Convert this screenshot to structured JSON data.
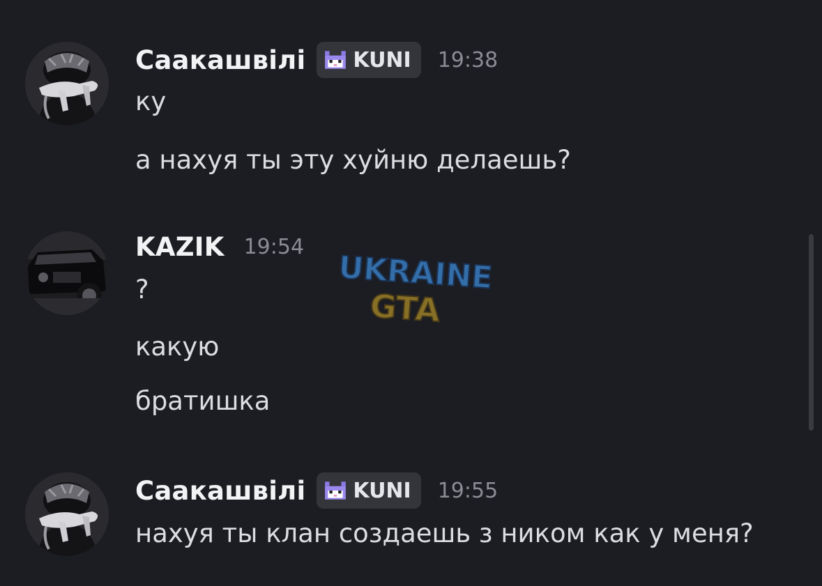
{
  "messages": [
    {
      "username": "Саакашвілі",
      "tag": "KUNI",
      "time": "19:38",
      "lines": [
        "ку",
        "а нахуя ты эту хуйню делаешь?"
      ]
    },
    {
      "username": "KAZIK",
      "time": "19:54",
      "lines": [
        "?",
        "какую",
        "братишка"
      ]
    },
    {
      "username": "Саакашвілі",
      "tag": "KUNI",
      "time": "19:55",
      "lines": [
        "нахуя ты клан создаешь з ником как у меня?"
      ]
    }
  ],
  "watermark": {
    "line1": "UKRAINE",
    "line2": "GTA"
  },
  "icons": {
    "tag_icon": "pixel-cat-icon"
  },
  "colors": {
    "background": "#1c1d22",
    "username": "#f2f3f5",
    "text": "#dcdde1",
    "timestamp": "#8b8d94",
    "tag_bg": "#34353b",
    "watermark_blue": "#3d8ad6",
    "watermark_yellow": "#e0b52a"
  }
}
